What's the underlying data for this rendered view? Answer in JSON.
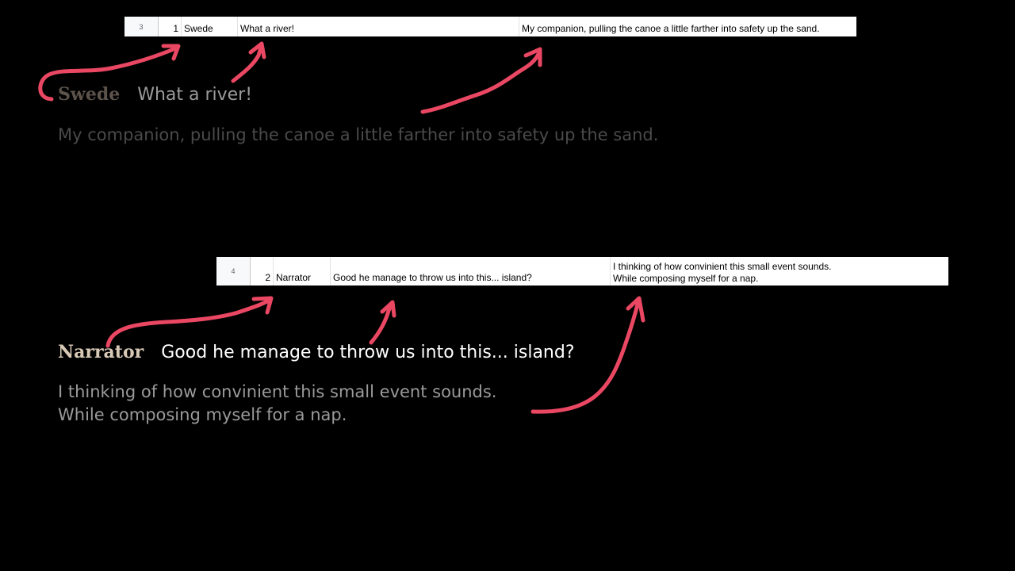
{
  "rows": [
    {
      "row_number": "3",
      "index": "1",
      "speaker": "Swede",
      "line": "What a river!",
      "note_line1": "My companion, pulling the canoe a little farther into safety up the sand.",
      "note_line2": ""
    },
    {
      "row_number": "4",
      "index": "2",
      "speaker": "Narrator",
      "line": "Good he manage to throw us into this... island?",
      "note_line1": "I thinking of how convinient this small event sounds.",
      "note_line2": "While composing myself for a nap."
    }
  ],
  "dialogue": [
    {
      "name": "Swede",
      "text": "What a river!",
      "narration": "My companion, pulling the canoe a little farther into safety up the sand."
    },
    {
      "name": "Narrator",
      "text": "Good he manage to throw us into this... island?",
      "narration_line1": "I thinking of how convinient this small event sounds.",
      "narration_line2": "While composing myself for a nap."
    }
  ],
  "colors": {
    "background": "#000000",
    "arrow": "#ea4763"
  },
  "icons": [
    "hand-drawn-arrow-icon"
  ]
}
